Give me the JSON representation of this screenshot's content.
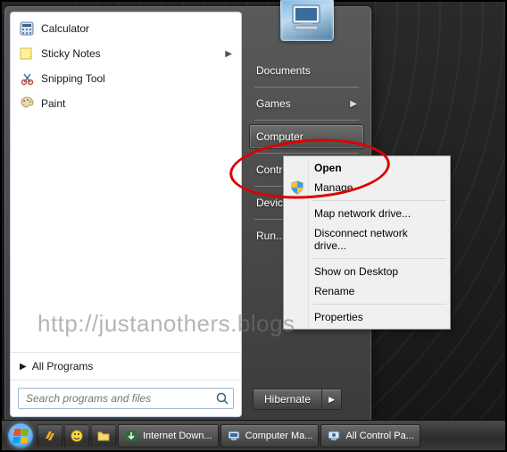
{
  "start_menu": {
    "pinned": [
      {
        "label": "Calculator",
        "icon": "calculator-icon",
        "has_flyout": false
      },
      {
        "label": "Sticky Notes",
        "icon": "stickynotes-icon",
        "has_flyout": true
      },
      {
        "label": "Snipping Tool",
        "icon": "snipping-icon",
        "has_flyout": false
      },
      {
        "label": "Paint",
        "icon": "paint-icon",
        "has_flyout": false
      }
    ],
    "all_programs_label": "All Programs",
    "search_placeholder": "Search programs and files",
    "right": [
      {
        "label": "Documents"
      },
      {
        "label": "Games",
        "has_flyout": true
      },
      {
        "label": "Computer",
        "highlighted": true
      },
      {
        "label": "Control Panel"
      },
      {
        "label": "Devices and Printers"
      },
      {
        "label": "Run..."
      }
    ],
    "shutdown_label": "Hibernate"
  },
  "context_menu": {
    "items": [
      {
        "label": "Open",
        "bold": true
      },
      {
        "label": "Manage",
        "icon": "shield-icon"
      },
      {
        "sep": true
      },
      {
        "label": "Map network drive..."
      },
      {
        "label": "Disconnect network drive..."
      },
      {
        "sep": true
      },
      {
        "label": "Show on Desktop"
      },
      {
        "label": "Rename"
      },
      {
        "sep": true
      },
      {
        "label": "Properties"
      }
    ]
  },
  "taskbar": {
    "tasks": [
      {
        "label": "Internet Down...",
        "icon": "idm-icon"
      },
      {
        "label": "Computer Ma...",
        "icon": "compmgmt-icon"
      },
      {
        "label": "All Control Pa...",
        "icon": "ctrlpanel-icon"
      }
    ]
  },
  "watermark": "http://justanothers.blogs",
  "colors": {
    "annotation": "#d00"
  }
}
